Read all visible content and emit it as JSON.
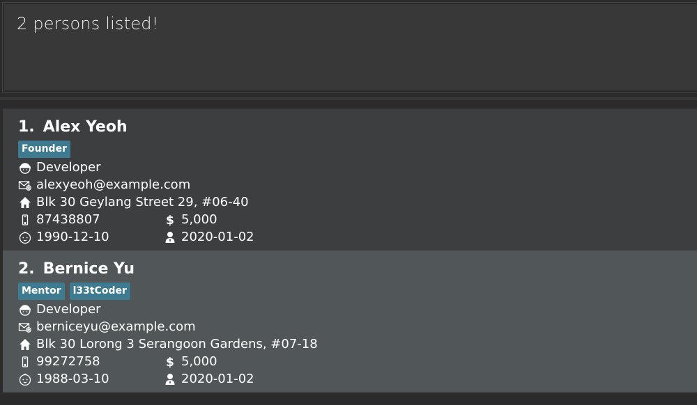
{
  "result": {
    "message": "2 persons listed!"
  },
  "persons": [
    {
      "index": "1.",
      "name": "Alex Yeoh",
      "tags": [
        "Founder"
      ],
      "occupation": "Developer",
      "email": "alexyeoh@example.com",
      "address": "Blk 30 Geylang Street 29, #06-40",
      "phone": "87438807",
      "salary": "5,000",
      "birthday": "1990-12-10",
      "join_date": "2020-01-02"
    },
    {
      "index": "2.",
      "name": "Bernice Yu",
      "tags": [
        "Mentor",
        "l33tCoder"
      ],
      "occupation": "Developer",
      "email": "berniceyu@example.com",
      "address": "Blk 30 Lorong 3 Serangoon Gardens, #07-18",
      "phone": "99272758",
      "salary": "5,000",
      "birthday": "1988-03-10",
      "join_date": "2020-01-02"
    }
  ],
  "colors": {
    "tag_bg": "#3e7b91",
    "card_odd": "#3c3e3f",
    "card_even": "#515658",
    "background": "#2b2b2b"
  },
  "icons": [
    "worker-helmet-icon",
    "email-icon",
    "home-icon",
    "mobile-phone-icon",
    "dollar-icon",
    "baby-face-icon",
    "person-icon"
  ]
}
